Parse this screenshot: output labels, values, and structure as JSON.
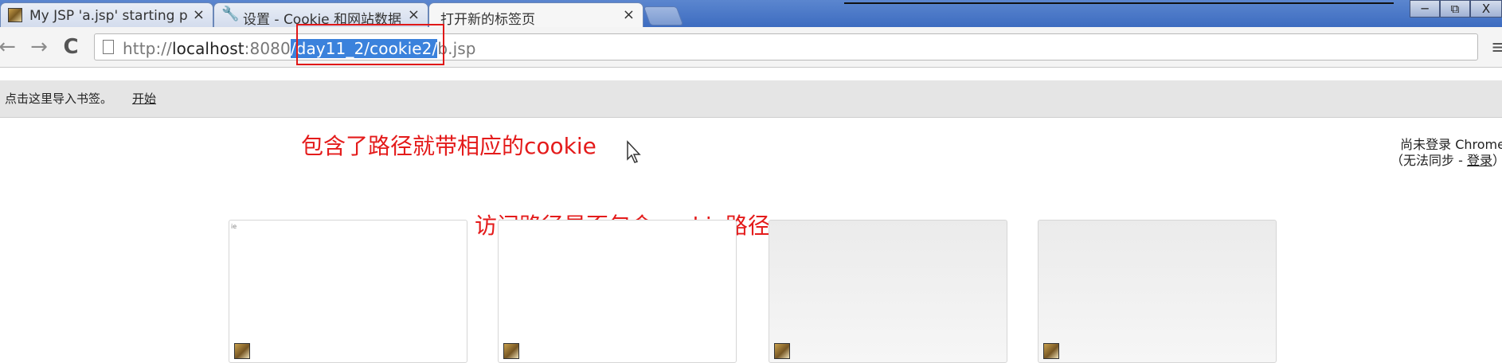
{
  "tabs": [
    {
      "title": "My JSP 'a.jsp' starting p",
      "close": "×",
      "icon": "jsp-page-icon"
    },
    {
      "title": "设置 - Cookie 和网站数据",
      "close": "×",
      "icon": "wrench-icon"
    },
    {
      "title": "打开新的标签页",
      "close": "×",
      "active": true
    }
  ],
  "window_controls": {
    "minimize": "─",
    "restore": "⧉",
    "close": "X"
  },
  "toolbar": {
    "back": "←",
    "forward": "→",
    "reload": "C",
    "menu": "≡"
  },
  "address": {
    "scheme": "http://",
    "host": "localhost",
    "port": ":8080",
    "selected_path": "/day11_2/cookie2/",
    "rest": "b.jsp"
  },
  "bookmarks": {
    "prompt": "点击这里导入书签。",
    "link": "开始"
  },
  "annotations": {
    "top": "包含了路径就带相应的cookie",
    "middle": "访问路径是否包含cookie路径"
  },
  "signin": {
    "line1": "尚未登录 Chrome",
    "line2_prefix": "（无法同步 - ",
    "line2_link": "登录",
    "line2_suffix": "）"
  },
  "thumbnails": [
    {
      "label": "ie",
      "style": "white"
    },
    {
      "label": "",
      "style": "white"
    },
    {
      "label": "",
      "style": "grey"
    },
    {
      "label": "",
      "style": "grey"
    }
  ],
  "colors": {
    "annotation_red": "#e41b1b",
    "selection_blue": "#3b82dc",
    "tabstrip_blue": "#4a78c8"
  }
}
